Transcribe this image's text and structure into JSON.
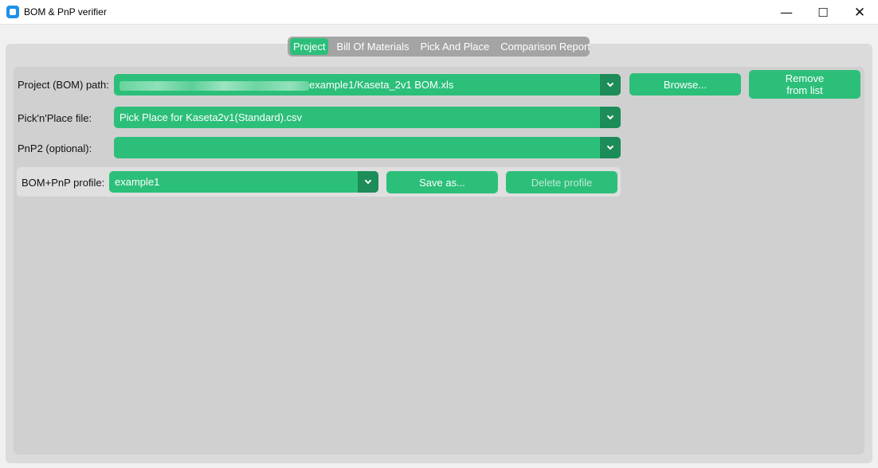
{
  "window": {
    "title": "BOM & PnP verifier",
    "icon": "app-icon",
    "controls": {
      "minimize": "—",
      "maximize": "☐",
      "close": "✕"
    }
  },
  "tabs": [
    {
      "label": "Project",
      "active": true
    },
    {
      "label": "Bill Of Materials",
      "active": false
    },
    {
      "label": "Pick And Place",
      "active": false
    },
    {
      "label": "Comparison Report",
      "active": false
    }
  ],
  "project": {
    "bom_path_label": "Project (BOM) path:",
    "bom_path_value": "example1/Kaseta_2v1 BOM.xls",
    "browse_label": "Browse...",
    "remove_label_line1": "Remove",
    "remove_label_line2": "from list",
    "pnp_label": "Pick'n'Place file:",
    "pnp_value": "Pick Place for Kaseta2v1(Standard).csv",
    "pnp2_label": "PnP2 (optional):",
    "pnp2_value": "",
    "profile_label": "BOM+PnP profile:",
    "profile_value": "example1",
    "save_as_label": "Save as...",
    "delete_profile_label": "Delete profile"
  },
  "colors": {
    "accent": "#2cbf7a",
    "accent_dark": "#1c8c58",
    "tab_bar": "#a4a4a4",
    "panel": "#d0d0d0"
  }
}
